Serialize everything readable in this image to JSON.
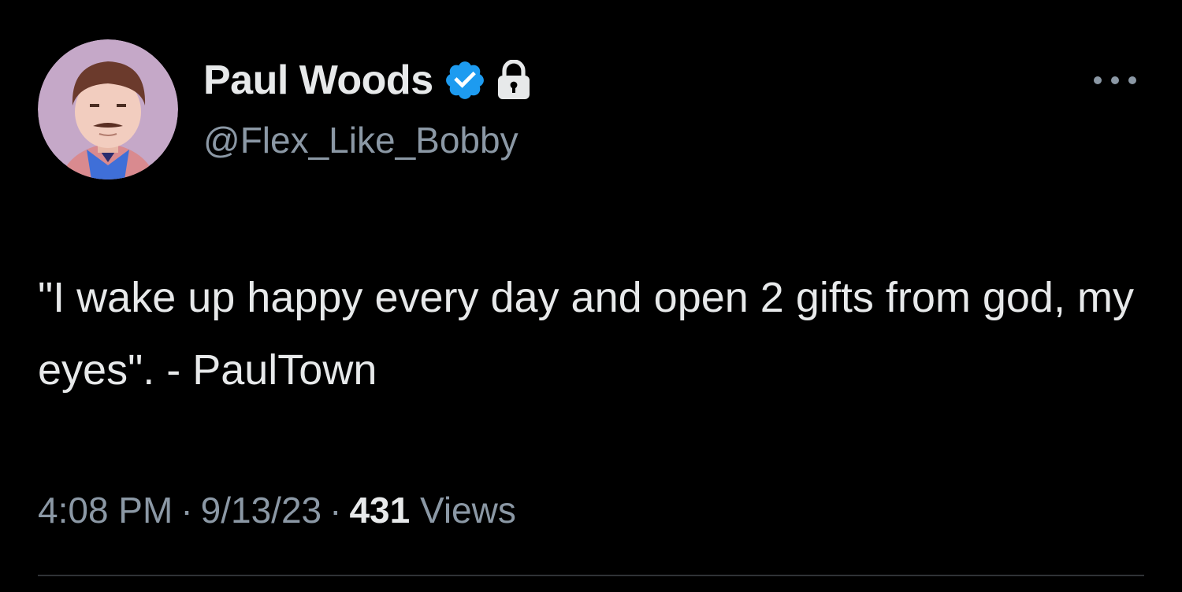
{
  "user": {
    "display_name": "Paul Woods",
    "handle": "@Flex_Like_Bobby",
    "verified": true,
    "protected": true
  },
  "tweet": {
    "text": "\"I wake up happy every day and open 2 gifts from god, my eyes\". - PaulTown"
  },
  "meta": {
    "time": "4:08 PM",
    "date": "9/13/23",
    "separator": "·",
    "views_count": "431",
    "views_label": "Views"
  },
  "icons": {
    "verified": "verified-badge-icon",
    "lock": "lock-icon",
    "more": "more-options-icon"
  },
  "colors": {
    "background": "#000000",
    "text_primary": "#e7e9ea",
    "text_secondary": "#8b98a5",
    "verified_blue": "#1d9bf0",
    "divider": "#2f3336"
  }
}
